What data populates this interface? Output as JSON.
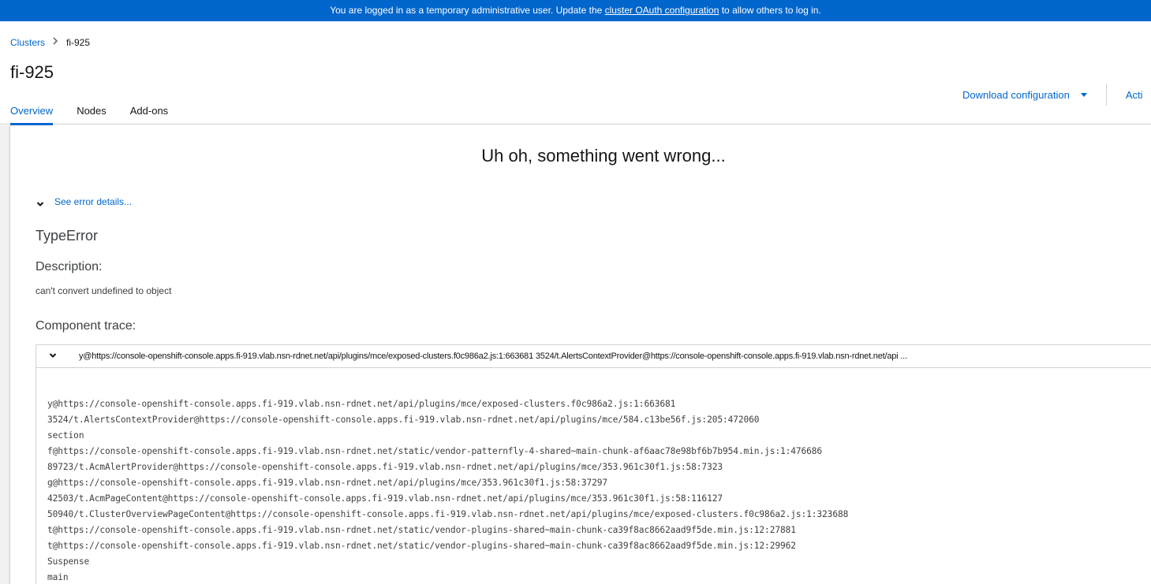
{
  "banner": {
    "text_before": "You are logged in as a temporary administrative user. Update the ",
    "link_text": "cluster OAuth configuration",
    "text_after": " to allow others to log in."
  },
  "breadcrumb": {
    "parent": "Clusters",
    "current": "fi-925"
  },
  "page": {
    "title": "fi-925"
  },
  "actions": {
    "download_config": "Download configuration",
    "actions_cut": "Acti"
  },
  "tabs": [
    {
      "label": "Overview",
      "active": true
    },
    {
      "label": "Nodes",
      "active": false
    },
    {
      "label": "Add-ons",
      "active": false
    }
  ],
  "error": {
    "title": "Uh oh, something went wrong...",
    "see_details": "See error details...",
    "type": "TypeError",
    "description_heading": "Description:",
    "description": "can't convert undefined to object",
    "trace_heading": "Component trace:",
    "trace_summary": "y@https://console-openshift-console.apps.fi-919.vlab.nsn-rdnet.net/api/plugins/mce/exposed-clusters.f0c986a2.js:1:663681 3524/t.AlertsContextProvider@https://console-openshift-console.apps.fi-919.vlab.nsn-rdnet.net/api ...",
    "trace_lines": [
      "y@https://console-openshift-console.apps.fi-919.vlab.nsn-rdnet.net/api/plugins/mce/exposed-clusters.f0c986a2.js:1:663681",
      "3524/t.AlertsContextProvider@https://console-openshift-console.apps.fi-919.vlab.nsn-rdnet.net/api/plugins/mce/584.c13be56f.js:205:472060",
      "section",
      "f@https://console-openshift-console.apps.fi-919.vlab.nsn-rdnet.net/static/vendor-patternfly-4-shared~main-chunk-af6aac78e98bf6b7b954.min.js:1:476686",
      "89723/t.AcmAlertProvider@https://console-openshift-console.apps.fi-919.vlab.nsn-rdnet.net/api/plugins/mce/353.961c30f1.js:58:7323",
      "g@https://console-openshift-console.apps.fi-919.vlab.nsn-rdnet.net/api/plugins/mce/353.961c30f1.js:58:37297",
      "42503/t.AcmPageContent@https://console-openshift-console.apps.fi-919.vlab.nsn-rdnet.net/api/plugins/mce/353.961c30f1.js:58:116127",
      "50940/t.ClusterOverviewPageContent@https://console-openshift-console.apps.fi-919.vlab.nsn-rdnet.net/api/plugins/mce/exposed-clusters.f0c986a2.js:1:323688",
      "t@https://console-openshift-console.apps.fi-919.vlab.nsn-rdnet.net/static/vendor-plugins-shared~main-chunk-ca39f8ac8662aad9f5de.min.js:12:27881",
      "t@https://console-openshift-console.apps.fi-919.vlab.nsn-rdnet.net/static/vendor-plugins-shared~main-chunk-ca39f8ac8662aad9f5de.min.js:12:29962",
      "Suspense",
      "main"
    ]
  },
  "icons": {
    "breadcrumb_separator": "chevron-right-icon",
    "dropdown": "caret-down-icon",
    "expand": "chevron-down-icon"
  },
  "colors": {
    "banner_bg": "#0066cc",
    "link": "#0066cc",
    "content_bg": "#f0f0f0"
  }
}
